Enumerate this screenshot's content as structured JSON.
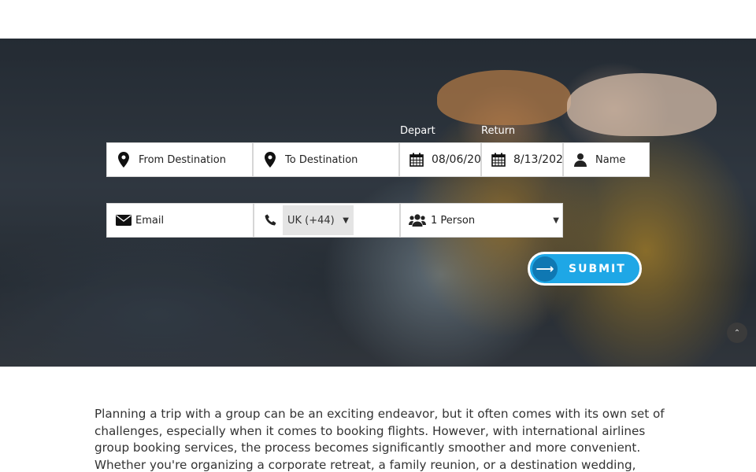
{
  "hero": {
    "form": {
      "from_placeholder": "From Destination",
      "to_placeholder": "To Destination",
      "depart_label": "Depart",
      "return_label": "Return",
      "depart_value": "08/06/20",
      "return_value": "8/13/202",
      "name_placeholder": "Name",
      "email_placeholder": "Email",
      "country_code": "UK (+44)",
      "persons": "1 Person",
      "submit_label": "SUBMIT"
    }
  },
  "intro": {
    "text": "Planning a trip with a group can be an exciting endeavor, but it often comes with its own set of challenges, especially when it comes to booking flights. However, with international airlines group booking services, the process becomes significantly smoother and more convenient. Whether you're organizing a corporate retreat, a family reunion, or a destination wedding,"
  },
  "icons": {
    "from": "map-marker-icon",
    "to": "map-marker-icon",
    "calendar": "calendar-icon",
    "user": "user-icon",
    "email": "envelope-icon",
    "phone": "phone-icon",
    "persons": "users-icon",
    "submit": "arrow-right-icon",
    "scroll_top": "double-chevron-up-icon"
  },
  "colors": {
    "accent": "#1ea7e6",
    "accent_dark": "#0f78b3"
  }
}
